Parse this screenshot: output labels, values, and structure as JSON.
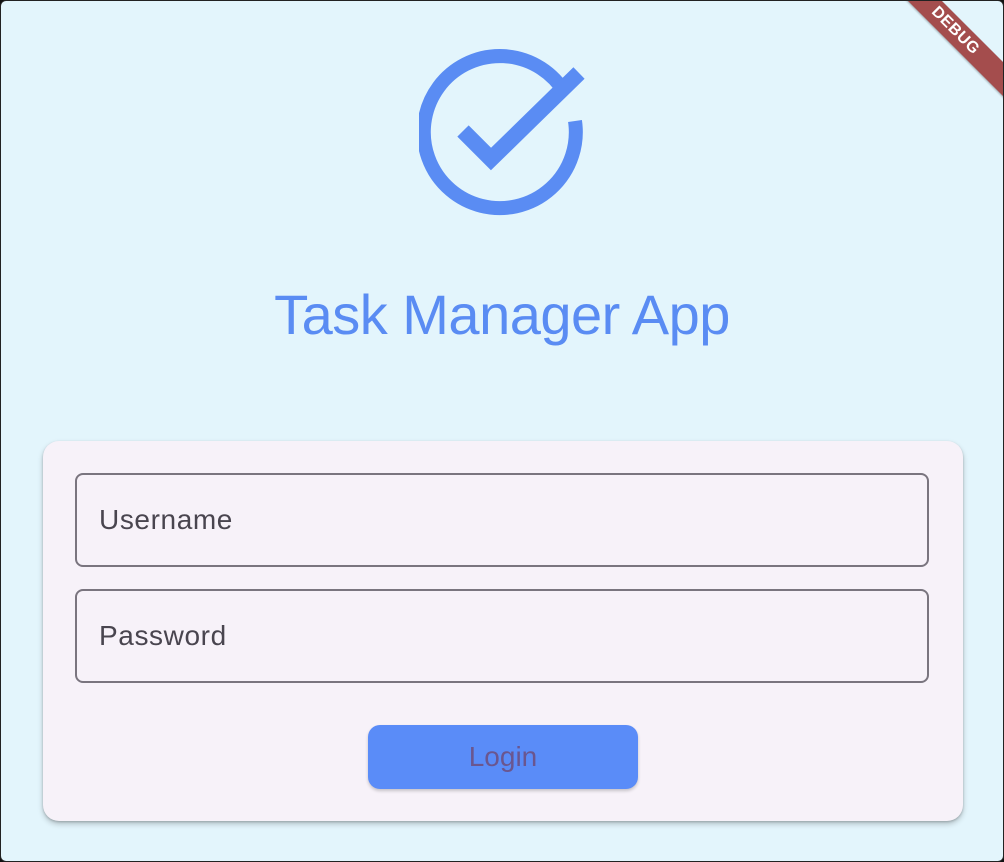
{
  "app": {
    "title": "Task Manager App",
    "logo_icon": "check-circle-icon",
    "accent_color": "#5a8cf3"
  },
  "login_form": {
    "username_placeholder": "Username",
    "password_placeholder": "Password",
    "login_label": "Login"
  },
  "debug_banner": {
    "label": "DEBUG",
    "color": "#a44d4d"
  }
}
